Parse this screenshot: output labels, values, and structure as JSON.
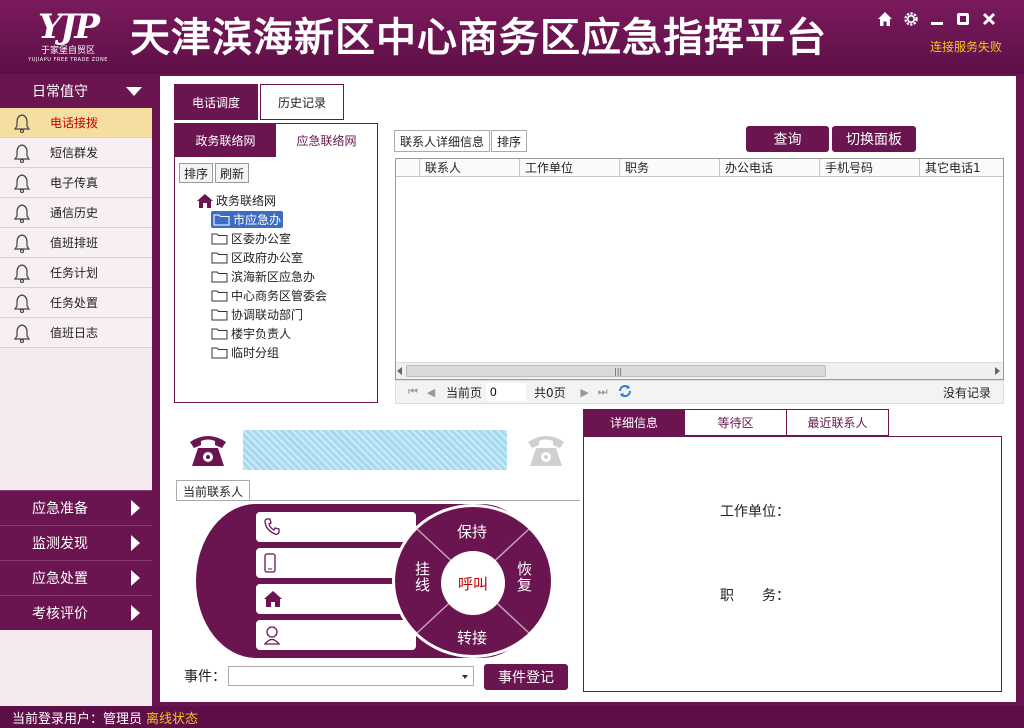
{
  "header": {
    "logo_mark": "YJP",
    "logo_cn": "于家堡自贸区",
    "logo_en": "YUJIAPU FREE TRADE ZONE",
    "title": "天津滨海新区中心商务区应急指挥平台",
    "connection_status": "连接服务失败",
    "icons": [
      "home-icon",
      "gear-icon",
      "minimize-icon",
      "maximize-icon",
      "close-icon"
    ]
  },
  "sidebar": {
    "section_title": "日常值守",
    "items": [
      {
        "label": "电话接拨",
        "active": true
      },
      {
        "label": "短信群发"
      },
      {
        "label": "电子传真"
      },
      {
        "label": "通信历史"
      },
      {
        "label": "值班排班"
      },
      {
        "label": "任务计划"
      },
      {
        "label": "任务处置"
      },
      {
        "label": "值班日志"
      }
    ],
    "categories": [
      "应急准备",
      "监测发现",
      "应急处置",
      "考核评价"
    ]
  },
  "main": {
    "tabs": [
      "电话调度",
      "历史记录"
    ],
    "tree_tabs": [
      "政务联络网",
      "应急联络网"
    ],
    "tree_buttons": [
      "排序",
      "刷新"
    ],
    "tree_root": "政务联络网",
    "tree_nodes": [
      "市应急办",
      "区委办公室",
      "区政府办公室",
      "滨海新区应急办",
      "中心商务区管委会",
      "协调联动部门",
      "楼宇负责人",
      "临时分组"
    ],
    "detail_buttons": [
      "联系人详细信息",
      "排序"
    ],
    "query_button": "查询",
    "switch_button": "切换面板",
    "grid_columns": [
      "联系人",
      "工作单位",
      "职务",
      "办公电话",
      "手机号码",
      "其它电话1"
    ],
    "pager": {
      "current_label": "当前页",
      "current_value": "0",
      "total_label": "共0页",
      "no_records": "没有记录"
    }
  },
  "phone": {
    "contact_tab": "当前联系人",
    "dial": {
      "top": "保持",
      "left": "挂线",
      "right": "恢复",
      "bottom": "转接",
      "center": "呼叫"
    },
    "event_label": "事件：",
    "event_button": "事件登记"
  },
  "info": {
    "tabs": [
      "详细信息",
      "等待区",
      "最近联系人"
    ],
    "unit_label": "工作单位：",
    "position_label": "职　　务："
  },
  "status": {
    "user_label": "当前登录用户：管理员",
    "state": "离线状态"
  },
  "colors": {
    "brand": "#6a1550",
    "active_item_bg": "#f5dfa0",
    "active_item_text": "#c00000",
    "status_warning": "#f5c518"
  }
}
